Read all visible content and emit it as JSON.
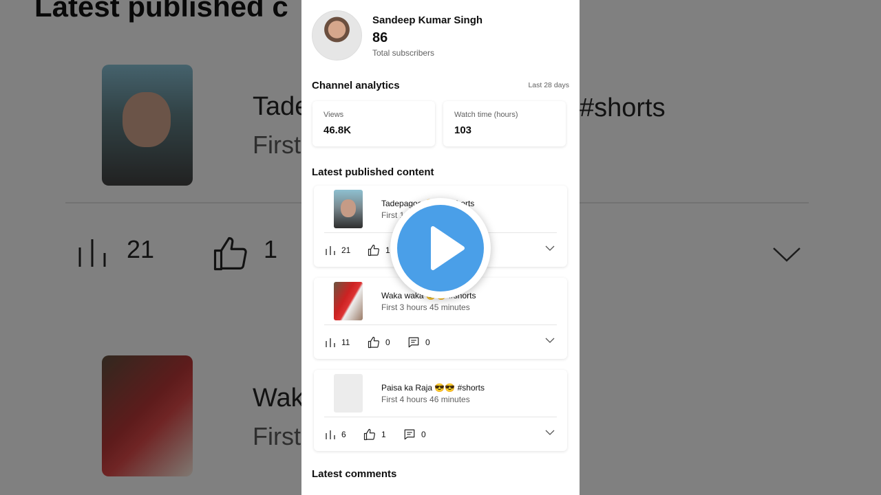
{
  "background": {
    "title": "Latest published c",
    "item1_title": "Tade",
    "item1_tag": "#shorts",
    "item1_sub": "First",
    "item2_title": "Wak",
    "item2_sub": "First",
    "views": "21",
    "likes": "1"
  },
  "channel": {
    "name": "Sandeep Kumar Singh",
    "subscribers": "86",
    "subscribers_label": "Total subscribers"
  },
  "analytics": {
    "title": "Channel analytics",
    "range": "Last 28 days",
    "views_label": "Views",
    "views_value": "46.8K",
    "watch_label": "Watch time (hours)",
    "watch_value": "103"
  },
  "latest_content": {
    "title": "Latest published content",
    "items": [
      {
        "title": "Tadepagoo 😎😎 #shorts",
        "subtitle": "First 1",
        "views": "21",
        "likes": "1",
        "comments": ""
      },
      {
        "title": "Waka waka 😎😎 #shorts",
        "subtitle": "First 3 hours 45 minutes",
        "views": "11",
        "likes": "0",
        "comments": "0"
      },
      {
        "title": "Paisa ka Raja 😎😎 #shorts",
        "subtitle": "First 4 hours 46 minutes",
        "views": "6",
        "likes": "1",
        "comments": "0"
      }
    ]
  },
  "latest_comments": {
    "title": "Latest comments"
  },
  "colors": {
    "accent": "#4a9fe8",
    "panel": "#ffffff",
    "muted": "#606060"
  },
  "icons": {
    "views": "bar-chart-icon",
    "likes": "thumb-up-icon",
    "comments": "comment-icon",
    "expand": "chevron-down-icon",
    "play": "play-icon"
  }
}
